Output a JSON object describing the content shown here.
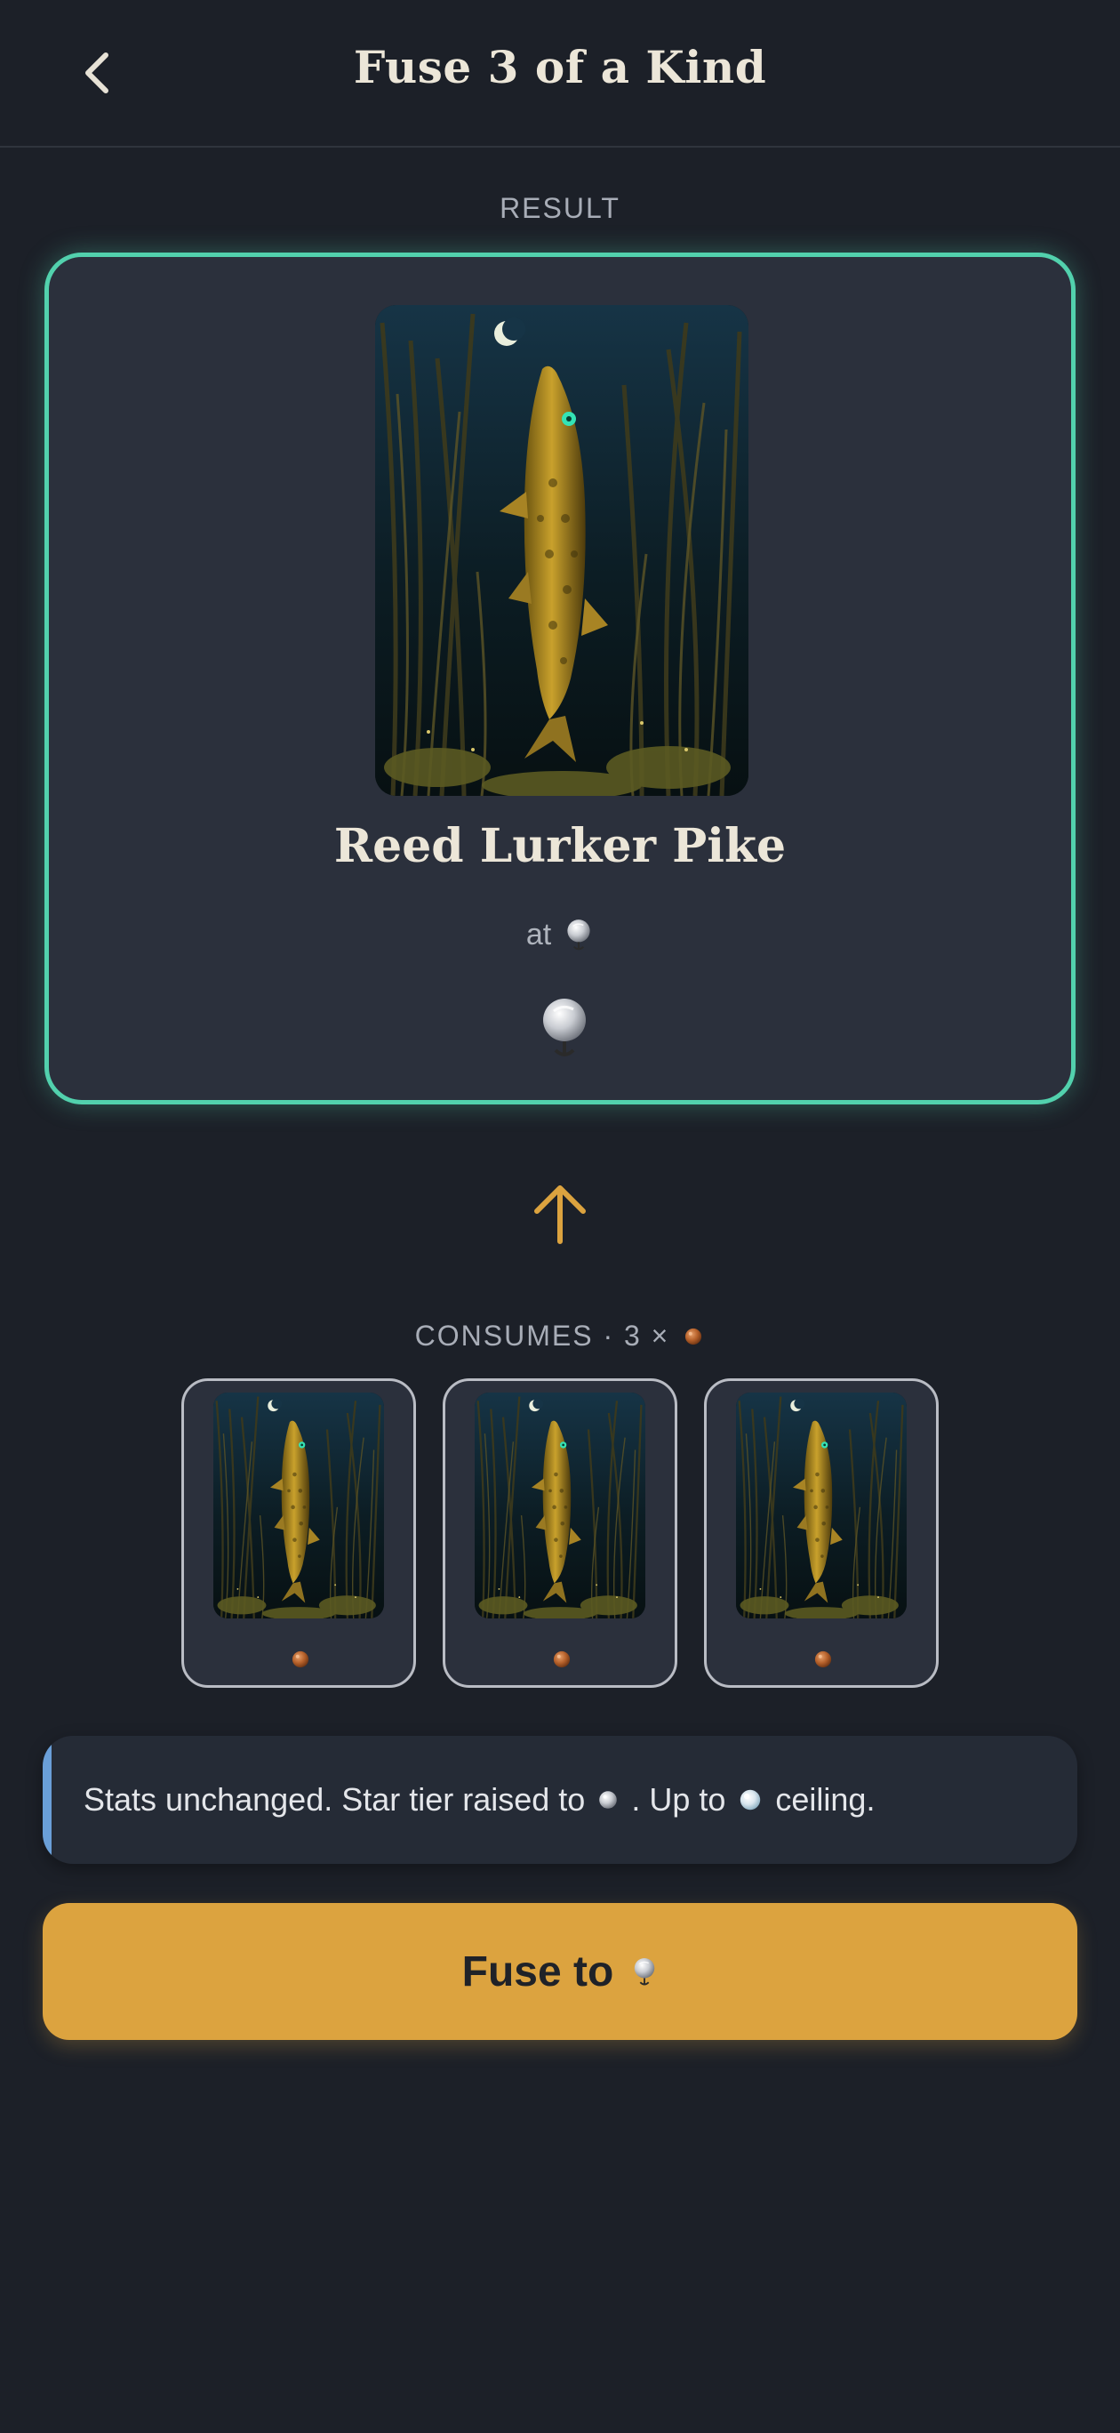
{
  "header": {
    "title": "Fuse 3 of a Kind",
    "back_icon": "chevron-left-icon"
  },
  "result": {
    "section_label": "RESULT",
    "fish_name": "Reed Lurker Pike",
    "at_label": "at",
    "accent_color": "#52d1ad"
  },
  "consumes": {
    "label": "CONSUMES · 3 ×",
    "count": 3
  },
  "info": {
    "text_before": "Stats unchanged. Star tier raised to",
    "text_middle": ". Up to",
    "text_after": "ceiling."
  },
  "fuse_button": {
    "label": "Fuse to",
    "color": "#dca33f"
  },
  "icons": {
    "arrow": "arrow-up-icon",
    "bronze_tier": "bronze-tier-icon",
    "silver_tier": "silver-tier-icon",
    "pearl_tier": "pearl-tier-icon"
  }
}
